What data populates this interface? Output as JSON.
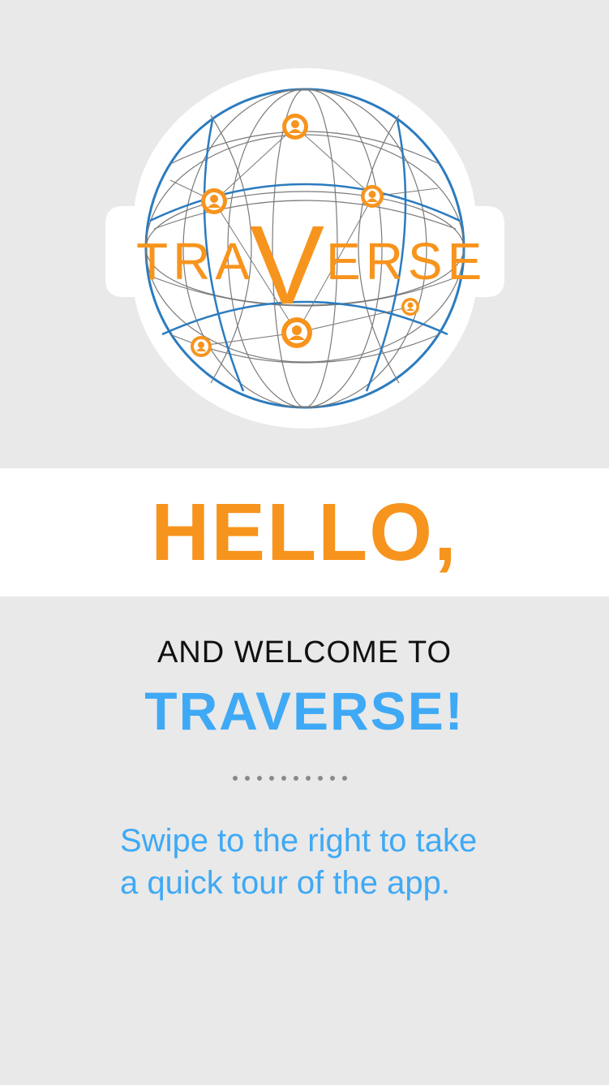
{
  "logo": {
    "wordmark_left": "TRA",
    "wordmark_center": "V",
    "wordmark_right": "ERSE",
    "icon": "globe-network-icon"
  },
  "hero": {
    "headline": "HELLO,"
  },
  "welcome": {
    "intro": "AND WELCOME TO",
    "brand": "TRAVERSE!"
  },
  "pager": {
    "dot_count": 10
  },
  "instructions": {
    "line1": "Swipe to the right to take",
    "line2": "a quick tour of the app."
  },
  "colors": {
    "background": "#e9e9e9",
    "band": "#ffffff",
    "orange": "#f7941d",
    "blue": "#3fa9f5",
    "globe_blue": "#2b7bbf"
  }
}
